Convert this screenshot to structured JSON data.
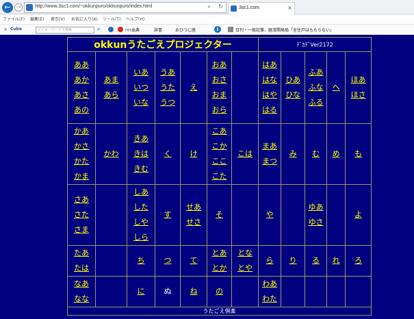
{
  "browser": {
    "url": "http://www.3sc1.com/~okkunpuro/okkunpuro/index.html",
    "tab_title": "3sc1.com",
    "menu": [
      "ファイル(F)",
      "編集(E)",
      "表示(V)",
      "お気に入り(A)",
      "ツール(T)",
      "ヘルプ(H)"
    ],
    "toolbar": {
      "cube_label": "Cube",
      "search_placeholder": "マイキーワードで検索",
      "item_1": "ﾊｲﾄ出典",
      "item_2": "辞書",
      "item_3": "おひつじ座",
      "news": "日刊・一般記事、経済開発局「全住戸はもたらない」"
    }
  },
  "page": {
    "title": "okkunうたごえプロジェクター",
    "version": "ﾃﾞｶﾃﾞVer2172",
    "footer": "うたごえ倶楽",
    "rows": [
      [
        [
          "ああ",
          "あか",
          "あさ",
          "あの"
        ],
        [
          "あま",
          "あら"
        ],
        [
          "いあ",
          "いつ",
          "いな"
        ],
        [
          "うあ",
          "うた",
          "うつ"
        ],
        [
          "え"
        ],
        [
          "おあ",
          "おさ",
          "おま",
          "おら"
        ],
        [],
        [
          "はあ",
          "はな",
          "はや",
          "はる"
        ],
        [
          "ひあ",
          "ひな"
        ],
        [
          "ふあ",
          "ふな",
          "ふる"
        ],
        [
          "へ"
        ],
        [
          "ほあ",
          "ほさ"
        ]
      ],
      [
        [
          "かあ",
          "かさ",
          "かた",
          "かま"
        ],
        [
          "かわ"
        ],
        [
          "きあ",
          "きは",
          "きむ"
        ],
        [
          "く"
        ],
        [
          "け"
        ],
        [
          "こあ",
          "こか",
          "ここ",
          "こた"
        ],
        [
          "こは"
        ],
        [
          "まあ",
          "まつ"
        ],
        [
          "み"
        ],
        [
          "む"
        ],
        [
          "め"
        ],
        [
          "も"
        ]
      ],
      [
        [
          "さあ",
          "さた",
          "さま"
        ],
        [],
        [
          "しあ",
          "した",
          "しや",
          "しら"
        ],
        [
          "す"
        ],
        [
          "せあ",
          "せさ"
        ],
        [
          "そ"
        ],
        [],
        [
          "や"
        ],
        [],
        [
          "ゆあ",
          "ゆさ"
        ],
        [],
        [
          "よ"
        ]
      ],
      [
        [
          "たあ",
          "たは"
        ],
        [],
        [
          "ち"
        ],
        [
          "つ"
        ],
        [
          "て"
        ],
        [
          "とあ",
          "とか"
        ],
        [
          "とな",
          "とや"
        ],
        [
          "ら"
        ],
        [
          "り"
        ],
        [
          "る"
        ],
        [
          "れ"
        ],
        [
          "ろ"
        ]
      ],
      [
        [
          "なあ",
          "なな"
        ],
        [],
        [
          "に"
        ],
        [
          "ぬ"
        ],
        [
          "ね"
        ],
        [
          "の"
        ],
        [],
        [
          "わあ",
          "わた"
        ],
        [],
        [],
        [],
        []
      ]
    ],
    "plain_cells": [
      "ぬ"
    ]
  },
  "colors": {
    "background": "#000080",
    "link": "#ffff00",
    "border": "#9a9a62"
  }
}
